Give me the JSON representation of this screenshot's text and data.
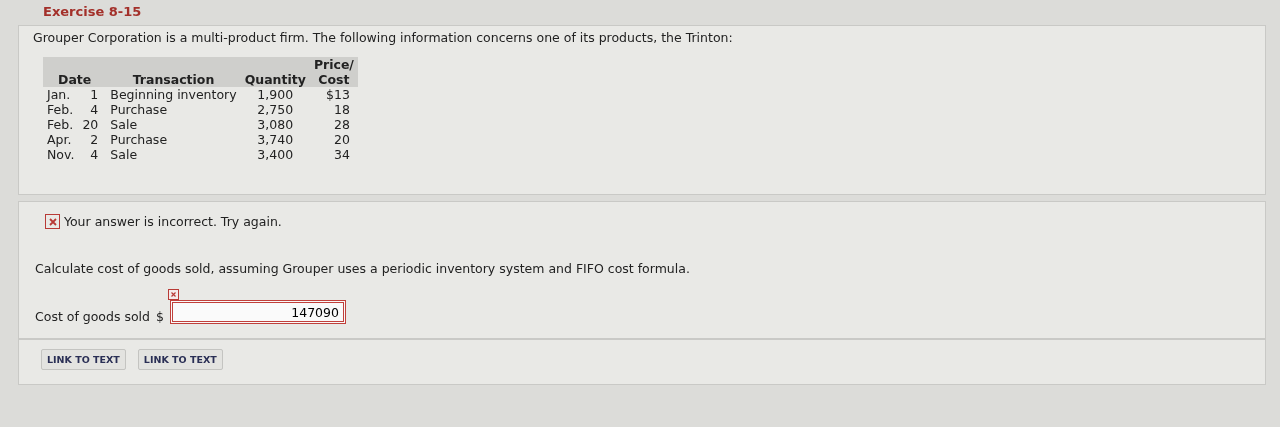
{
  "exercise": {
    "title": "Exercise 8-15",
    "intro": "Grouper Corporation is a multi-product firm. The following information concerns one of its products, the Trinton:"
  },
  "table": {
    "columns": [
      "Date",
      "Transaction",
      "Quantity",
      "Price/ Cost"
    ],
    "rows": [
      {
        "month": "Jan.",
        "day": "1",
        "transaction": "Beginning inventory",
        "quantity": "1,900",
        "cost": "$13"
      },
      {
        "month": "Feb.",
        "day": "4",
        "transaction": "Purchase",
        "quantity": "2,750",
        "cost": "18"
      },
      {
        "month": "Feb.",
        "day": "20",
        "transaction": "Sale",
        "quantity": "3,080",
        "cost": "28"
      },
      {
        "month": "Apr.",
        "day": "2",
        "transaction": "Purchase",
        "quantity": "3,740",
        "cost": "20"
      },
      {
        "month": "Nov.",
        "day": "4",
        "transaction": "Sale",
        "quantity": "3,400",
        "cost": "34"
      }
    ]
  },
  "feedback": {
    "correct": false,
    "message": "Your answer is incorrect.  Try again."
  },
  "question": "Calculate cost of goods sold, assuming Grouper uses a periodic inventory system and FIFO cost formula.",
  "answer": {
    "label": "Cost of goods sold",
    "currency": "$",
    "value": "147090",
    "incorrect": true
  },
  "buttons": [
    "LINK TO TEXT",
    "LINK TO TEXT"
  ]
}
